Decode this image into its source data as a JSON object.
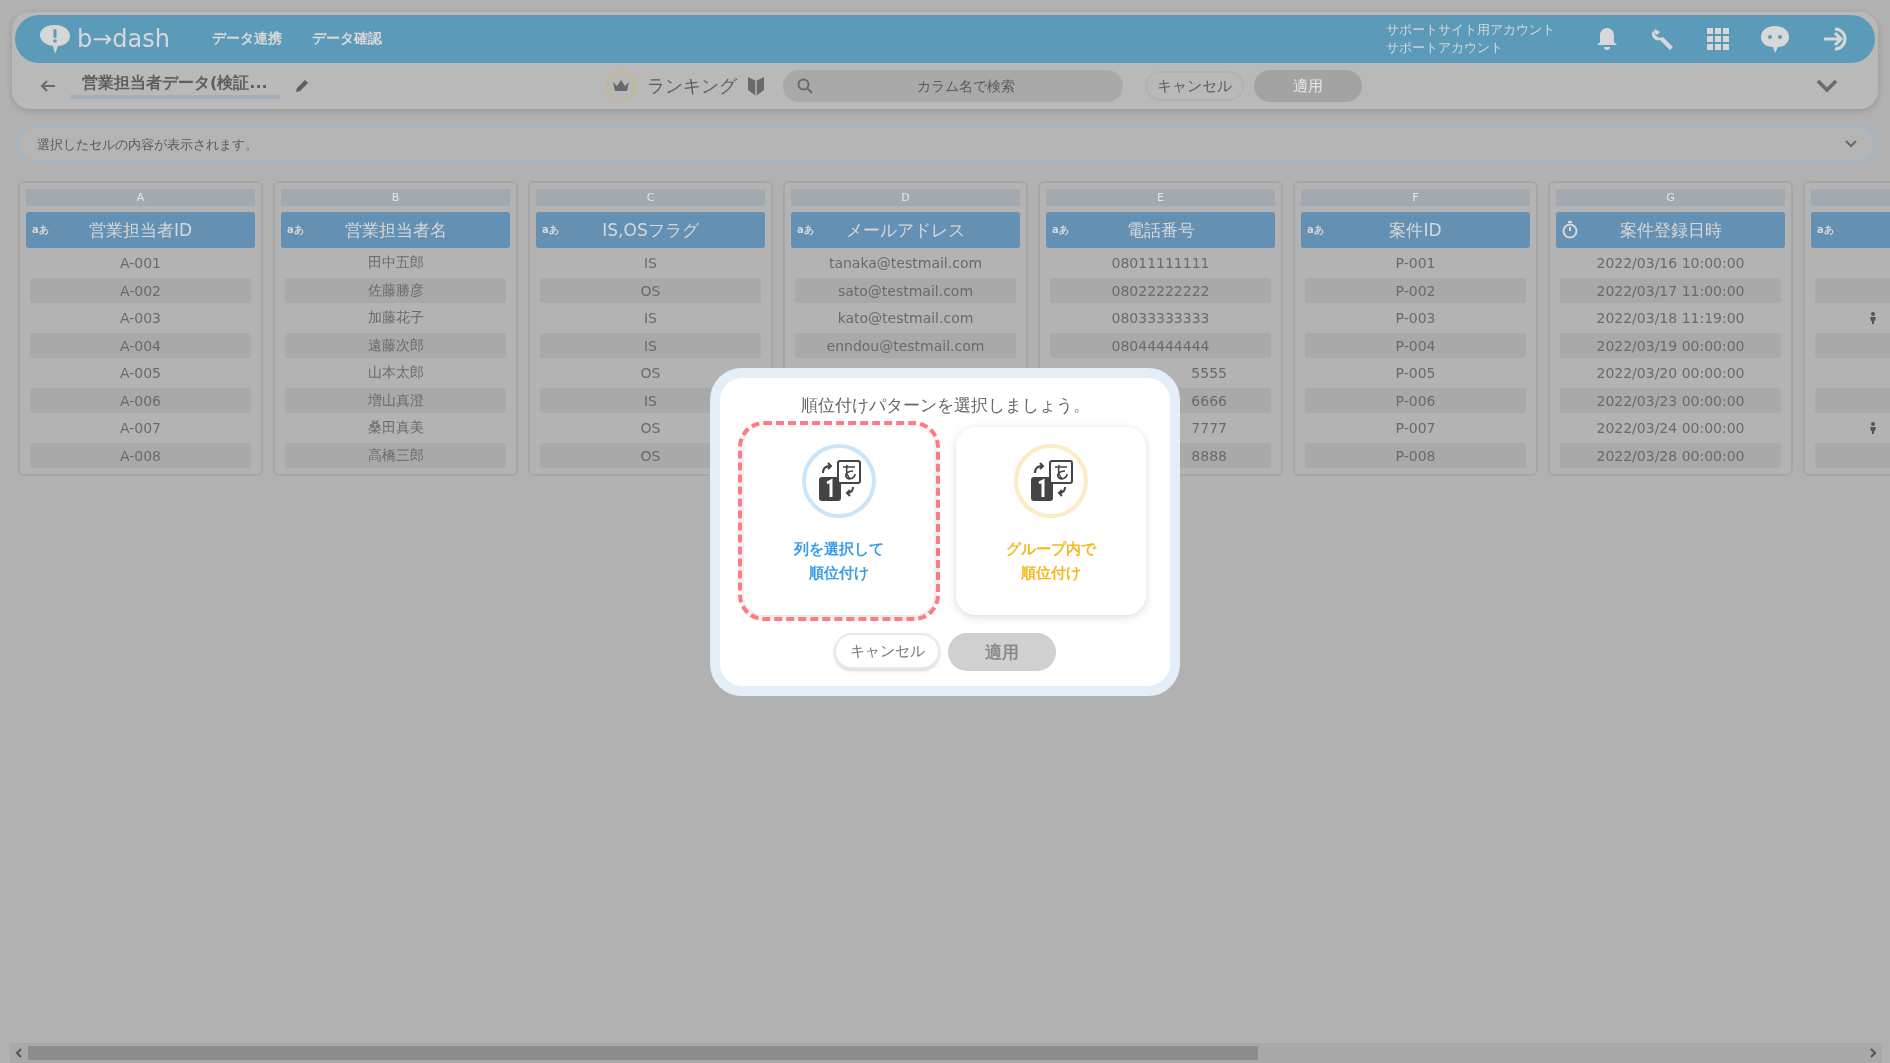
{
  "header": {
    "logo_text": "b→dash",
    "nav": [
      "データ連携",
      "データ確認"
    ],
    "account": [
      "サポートサイト用アカウント",
      "サポートアカウント"
    ]
  },
  "toolbar": {
    "title": "営業担当者データ(検証...",
    "mode_label": "ランキング",
    "search": {
      "placeholder": "カラム名で検索"
    },
    "cancel": "キャンセル",
    "apply": {
      "label": "適用",
      "disabled": true
    }
  },
  "cell_view": {
    "placeholder": "選択したセルの内容が表示されます。"
  },
  "table": {
    "columns": [
      {
        "letter": "A",
        "kind": "text",
        "type_label": "aあ",
        "name": "営業担当者ID",
        "cells": [
          {
            "text": "A-001"
          },
          {
            "text": "A-002"
          },
          {
            "text": "A-003"
          },
          {
            "text": "A-004"
          },
          {
            "text": "A-005"
          },
          {
            "text": "A-006"
          },
          {
            "text": "A-007"
          },
          {
            "text": "A-008"
          }
        ]
      },
      {
        "letter": "B",
        "kind": "text",
        "type_label": "aあ",
        "name": "営業担当者名",
        "cells": [
          {
            "text": "田中五郎"
          },
          {
            "text": "佐藤勝彦"
          },
          {
            "text": "加藤花子"
          },
          {
            "text": "遠藤次郎"
          },
          {
            "text": "山本太郎"
          },
          {
            "text": "増山真澄"
          },
          {
            "text": "桑田真美"
          },
          {
            "text": "高橋三郎"
          }
        ]
      },
      {
        "letter": "C",
        "kind": "text",
        "type_label": "aあ",
        "name": "IS,OSフラグ",
        "cells": [
          {
            "text": "IS"
          },
          {
            "text": "OS"
          },
          {
            "text": "IS"
          },
          {
            "text": "IS"
          },
          {
            "text": "OS"
          },
          {
            "text": "IS"
          },
          {
            "text": "OS"
          },
          {
            "text": "OS"
          }
        ]
      },
      {
        "letter": "D",
        "kind": "text",
        "type_label": "aあ",
        "name": "メールアドレス",
        "cells": [
          {
            "text": "tanaka@testmail.com"
          },
          {
            "text": "sato@testmail.com"
          },
          {
            "text": "kato@testmail.com"
          },
          {
            "text": "enndou@testmail.com"
          }
        ]
      },
      {
        "letter": "E",
        "kind": "text",
        "type_label": "aあ",
        "name": "電話番号",
        "cells": [
          {
            "text": "08011111111"
          },
          {
            "text": "08022222222"
          },
          {
            "text": "08033333333"
          },
          {
            "text": "08044444444"
          },
          {
            "text": "5555",
            "partial": true
          },
          {
            "text": "6666",
            "partial": true
          },
          {
            "text": "7777",
            "partial": true
          },
          {
            "text": "8888",
            "partial": true
          }
        ]
      },
      {
        "letter": "F",
        "kind": "text",
        "type_label": "aあ",
        "name": "案件ID",
        "cells": [
          {
            "text": "P-001"
          },
          {
            "text": "P-002"
          },
          {
            "text": "P-003"
          },
          {
            "text": "P-004"
          },
          {
            "text": "P-005"
          },
          {
            "text": "P-006"
          },
          {
            "text": "P-007"
          },
          {
            "text": "P-008"
          }
        ]
      },
      {
        "letter": "G",
        "kind": "datetime",
        "name": "案件登録日時",
        "cells": [
          {
            "text": "2022/03/16 10:00:00"
          },
          {
            "text": "2022/03/17 11:00:00"
          },
          {
            "text": "2022/03/18 11:19:00"
          },
          {
            "text": "2022/03/19 00:00:00"
          },
          {
            "text": "2022/03/20 00:00:00"
          },
          {
            "text": "2022/03/23 00:00:00"
          },
          {
            "text": "2022/03/24 00:00:00"
          },
          {
            "text": "2022/03/28 00:00:00"
          }
        ]
      },
      {
        "kind": "text",
        "type_label": "aあ",
        "cells": [
          {
            "figure": false
          },
          {
            "figure": false
          },
          {
            "figure": true
          },
          {
            "figure": false
          },
          {
            "figure": false
          },
          {
            "figure": false
          },
          {
            "figure": true
          },
          {
            "figure": false
          }
        ]
      }
    ]
  },
  "dialog": {
    "title": "順位付けパターンを選択しましょう。",
    "options": [
      {
        "lines": [
          "列を選択して",
          "順位付け"
        ],
        "color": "#3a9ce8",
        "selected": true
      },
      {
        "lines": [
          "グループ内で",
          "順位付け"
        ],
        "color": "#f5b820",
        "selected": false
      }
    ],
    "cancel": "キャンセル",
    "apply": {
      "label": "適用",
      "disabled": true
    }
  }
}
